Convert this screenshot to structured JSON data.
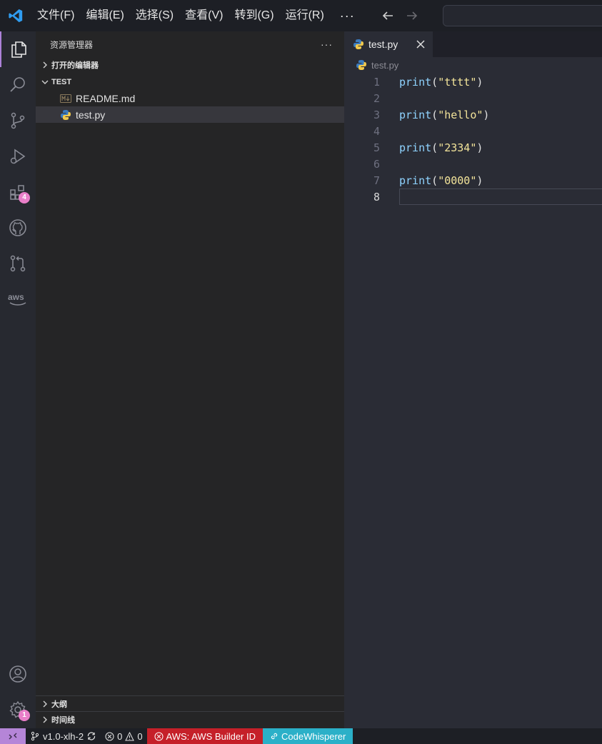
{
  "titlebar": {
    "menu": [
      "文件(F)",
      "编辑(E)",
      "选择(S)",
      "查看(V)",
      "转到(G)",
      "运行(R)"
    ],
    "more": "···"
  },
  "activity_bar": {
    "extensions_badge": "4",
    "settings_badge": "1"
  },
  "sidebar": {
    "title": "资源管理器",
    "more": "···",
    "open_editors": "打开的编辑器",
    "folder": "TEST",
    "files": [
      "README.md",
      "test.py"
    ],
    "outline": "大纲",
    "timeline": "时间线"
  },
  "editor": {
    "tab_label": "test.py",
    "breadcrumb": "test.py",
    "lines": [
      {
        "num": "1",
        "fn": "print",
        "str": "\"tttt\""
      },
      {
        "num": "2",
        "fn": "",
        "str": ""
      },
      {
        "num": "3",
        "fn": "print",
        "str": "\"hello\""
      },
      {
        "num": "4",
        "fn": "",
        "str": ""
      },
      {
        "num": "5",
        "fn": "print",
        "str": "\"2334\""
      },
      {
        "num": "6",
        "fn": "",
        "str": ""
      },
      {
        "num": "7",
        "fn": "print",
        "str": "\"0000\""
      },
      {
        "num": "8",
        "fn": "",
        "str": ""
      }
    ]
  },
  "statusbar": {
    "branch": "v1.0-xlh-2",
    "errors": "0",
    "warnings": "0",
    "aws": "AWS: AWS Builder ID",
    "codewhisperer": "CodeWhisperer"
  },
  "colors": {
    "accent": "#ad82d9",
    "badge": "#e97fc9",
    "aws": "#c52029",
    "codewhisperer": "#2bb0c8"
  }
}
